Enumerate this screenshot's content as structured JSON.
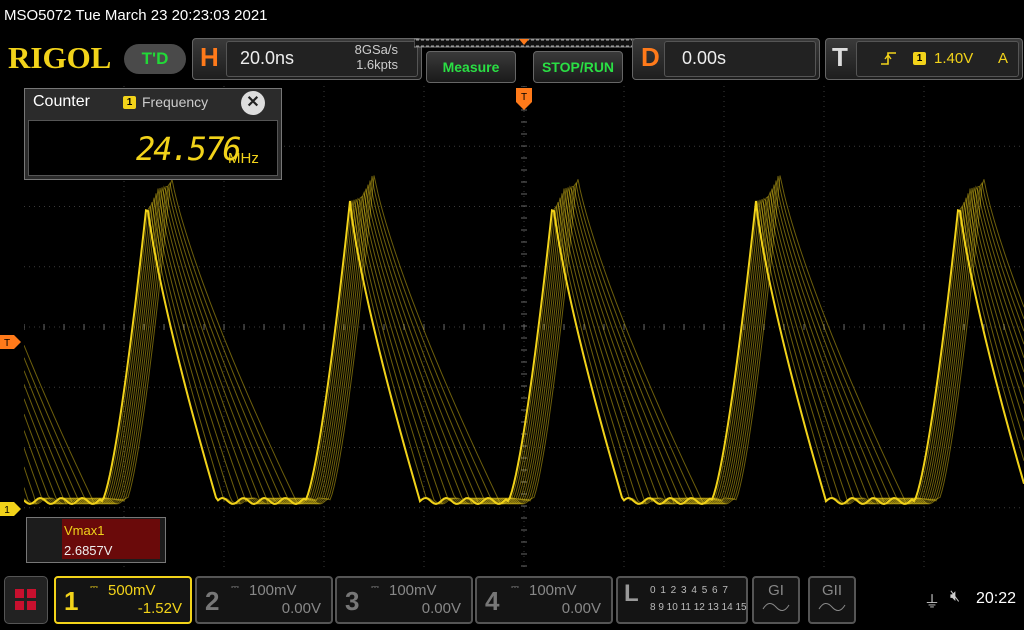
{
  "title": "MSO5072  Tue March 23 20:23:03 2021",
  "brand": "RIGOL",
  "run_state": "T'D",
  "horizontal": {
    "letter": "H",
    "timebase": "20.0ns",
    "sample_rate": "8GSa/s",
    "points": "1.6kpts"
  },
  "buttons": {
    "measure": "Measure",
    "stop_run": "STOP/RUN"
  },
  "delay": {
    "letter": "D",
    "value": "0.00s"
  },
  "trigger": {
    "letter": "T",
    "channel": "1",
    "level": "1.40V",
    "mode": "A",
    "edge_icon": "rising-edge-icon"
  },
  "counter": {
    "title": "Counter",
    "channel": "1",
    "mode": "Frequency",
    "close": "✕",
    "value": "24.576",
    "unit": "MHz"
  },
  "measurement": {
    "label": "Vmax1",
    "value": "2.6857V"
  },
  "markers": {
    "trigger_left": "T",
    "ch1_left": "1",
    "trigger_top": "T"
  },
  "channels": [
    {
      "num": "1",
      "scale": "500mV",
      "offset": "-1.52V",
      "active": true,
      "color": "#f2d31a"
    },
    {
      "num": "2",
      "scale": "100mV",
      "offset": "0.00V",
      "active": false,
      "color": "#888888"
    },
    {
      "num": "3",
      "scale": "100mV",
      "offset": "0.00V",
      "active": false,
      "color": "#888888"
    },
    {
      "num": "4",
      "scale": "100mV",
      "offset": "0.00V",
      "active": false,
      "color": "#888888"
    }
  ],
  "logic": {
    "letter": "L",
    "row1": "0 1 2 3  4 5 6 7",
    "row2": "8 9 10 11  12 13 14 15"
  },
  "generators": {
    "g1": "GI",
    "g2": "GII"
  },
  "status": {
    "usb": "⏚",
    "mute": "🔇︎",
    "clock": "20:22"
  },
  "colors": {
    "trace": "#f2d31a",
    "accent_orange": "#ff7a1a",
    "ok_green": "#2adf44"
  }
}
